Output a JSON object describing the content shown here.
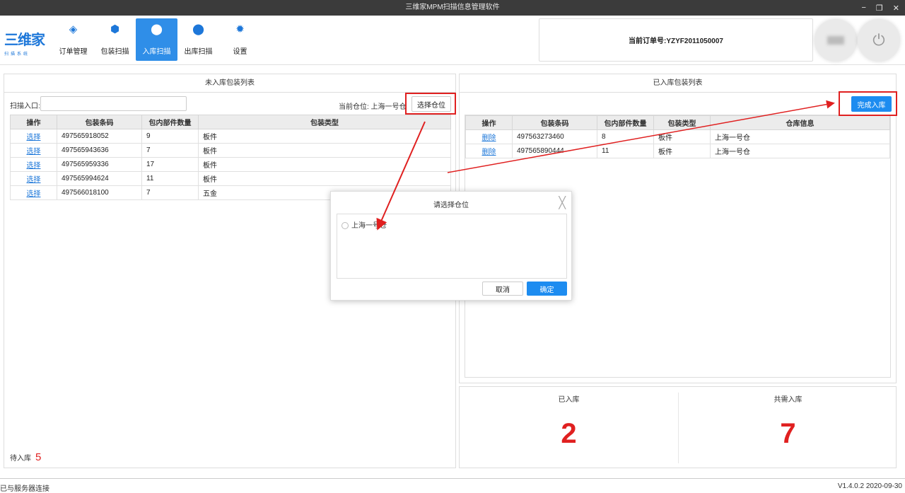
{
  "window": {
    "title": "三维家MPM扫描信息管理软件",
    "minimize": "−",
    "restore": "❐",
    "close": "✕"
  },
  "logo": {
    "brand": "三维家",
    "sub": "扫描系统"
  },
  "nav": [
    {
      "label": "订单管理",
      "icon": "layers-icon",
      "glyph": "◈"
    },
    {
      "label": "包装扫描",
      "icon": "box-icon",
      "glyph": "⬢"
    },
    {
      "label": "入库扫描",
      "icon": "inbound-icon",
      "glyph": "⬤"
    },
    {
      "label": "出库扫描",
      "icon": "outbound-icon",
      "glyph": "⬤"
    },
    {
      "label": "设置",
      "icon": "gear-icon",
      "glyph": "✹"
    }
  ],
  "order": {
    "text": "当前订单号:YZYF2011050007"
  },
  "left": {
    "title": "未入库包装列表",
    "scan_label": "扫描入口:",
    "scan_value": "",
    "current_loc_label": "当前仓位: 上海一号仓",
    "select_loc_btn": "选择仓位",
    "columns": [
      "操作",
      "包装条码",
      "包内部件数量",
      "包装类型"
    ],
    "rows": [
      [
        "选择",
        "497565918052",
        "9",
        "板件"
      ],
      [
        "选择",
        "497565943636",
        "7",
        "板件"
      ],
      [
        "选择",
        "497565959336",
        "17",
        "板件"
      ],
      [
        "选择",
        "497565994624",
        "11",
        "板件"
      ],
      [
        "选择",
        "497566018100",
        "7",
        "五金"
      ]
    ],
    "pending_label": "待入库",
    "pending_count": "5"
  },
  "right": {
    "title": "已入库包装列表",
    "finish_btn": "完成入库",
    "columns": [
      "操作",
      "包装条码",
      "包内部件数量",
      "包装类型",
      "仓库信息"
    ],
    "rows": [
      [
        "删除",
        "497563273460",
        "8",
        "板件",
        "上海一号仓"
      ],
      [
        "删除",
        "497565890444",
        "11",
        "板件",
        "上海一号仓"
      ]
    ]
  },
  "stats": {
    "done_label": "已入库",
    "done_value": "2",
    "total_label": "共需入库",
    "total_value": "7"
  },
  "dialog": {
    "title": "请选择仓位",
    "close": "╳",
    "option": "上海一号仓",
    "cancel": "取消",
    "ok": "确定"
  },
  "status": {
    "left": "已与服务器连接",
    "right": "V1.4.0.2 2020-09-30"
  },
  "colors": {
    "accent": "#1d8cf0",
    "annotation": "#e02020"
  }
}
